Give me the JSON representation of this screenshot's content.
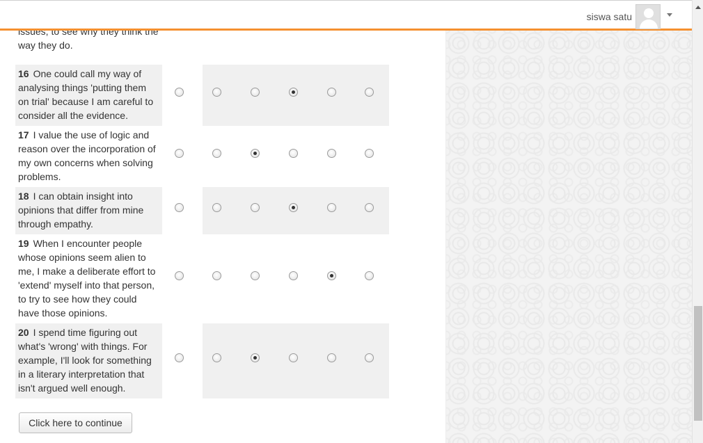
{
  "header": {
    "user_name": "siswa satu"
  },
  "fragment_text": "issues, to see why they think the way they do.",
  "questions": [
    {
      "number": "16",
      "text": "One could call my way of analysing things 'putting them on trial' because I am careful to consider all the evidence.",
      "selected_option": 4
    },
    {
      "number": "17",
      "text": "I value the use of logic and reason over the incorporation of my own concerns when solving problems.",
      "selected_option": 3
    },
    {
      "number": "18",
      "text": "I can obtain insight into opinions that differ from mine through empathy.",
      "selected_option": 4
    },
    {
      "number": "19",
      "text": "When I encounter people whose opinions seem alien to me, I make a deliberate effort to 'extend' myself into that person, to try to see how they could have those opinions.",
      "selected_option": 5
    },
    {
      "number": "20",
      "text": "I spend time figuring out what's 'wrong' with things. For example, I'll look for something in a literary interpretation that isn't argued well enough.",
      "selected_option": 3
    }
  ],
  "options_count": 6,
  "continue_label": "Click here to continue",
  "colors": {
    "accent_orange": "#f5902f",
    "row_shade": "#f0f0f0"
  }
}
